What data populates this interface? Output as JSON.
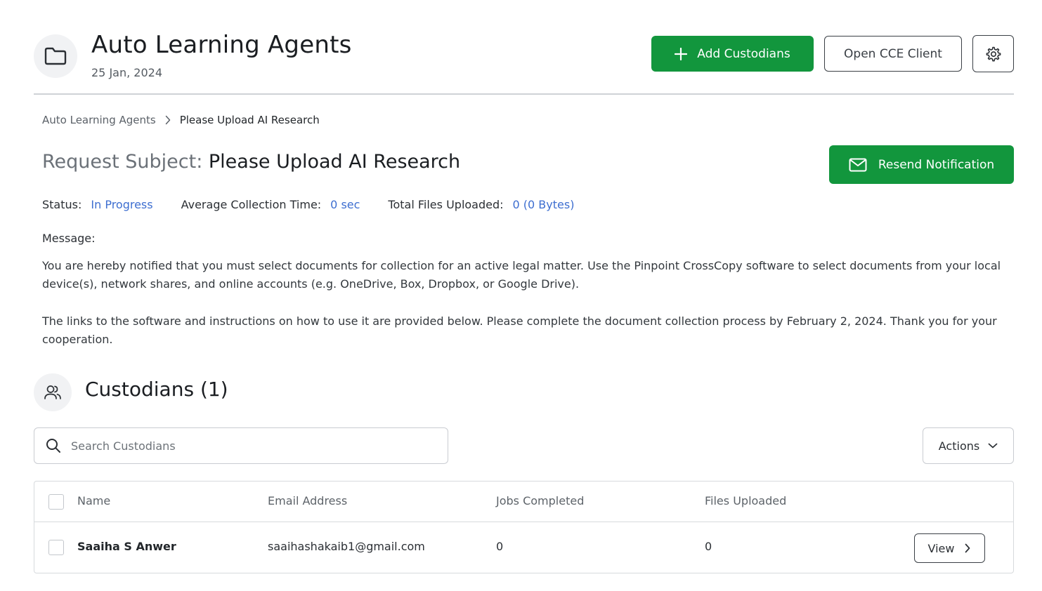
{
  "header": {
    "title": "Auto Learning Agents",
    "date": "25 Jan, 2024",
    "folder_icon": "folder-icon",
    "add_custodians_label": "Add Custodians",
    "open_cce_label": "Open CCE Client",
    "settings_icon": "gear-icon"
  },
  "breadcrumb": {
    "parent": "Auto Learning Agents",
    "current": "Please Upload AI Research"
  },
  "request": {
    "subject_label": "Request Subject:",
    "subject_value": "Please Upload AI Research",
    "resend_label": "Resend Notification",
    "status_label": "Status:",
    "status_value": "In Progress",
    "avg_time_label": "Average Collection Time:",
    "avg_time_value": "0 sec",
    "total_files_label": "Total Files Uploaded:",
    "total_files_value": "0 (0 Bytes)",
    "message_label": "Message:",
    "message_paragraphs": [
      "You are hereby notified that you must select documents for collection for an active legal matter. Use the Pinpoint CrossCopy software to select documents from your local device(s), network shares, and online accounts (e.g. OneDrive, Box, Dropbox, or Google Drive).",
      "The links to the software and instructions on how to use it are provided below. Please complete the document collection process by February 2, 2024. Thank you for your cooperation."
    ]
  },
  "custodians": {
    "title": "Custodians (1)",
    "search_placeholder": "Search Custodians",
    "actions_label": "Actions",
    "columns": [
      "Name",
      "Email Address",
      "Jobs Completed",
      "Files Uploaded"
    ],
    "rows": [
      {
        "name": "Saaiha S Anwer",
        "email": "saaihashakaib1@gmail.com",
        "jobs_completed": "0",
        "files_uploaded": "0",
        "view_label": "View"
      }
    ]
  },
  "colors": {
    "primary_green": "#12963d",
    "link_blue": "#3d6ed0",
    "border": "#d7dadd"
  }
}
